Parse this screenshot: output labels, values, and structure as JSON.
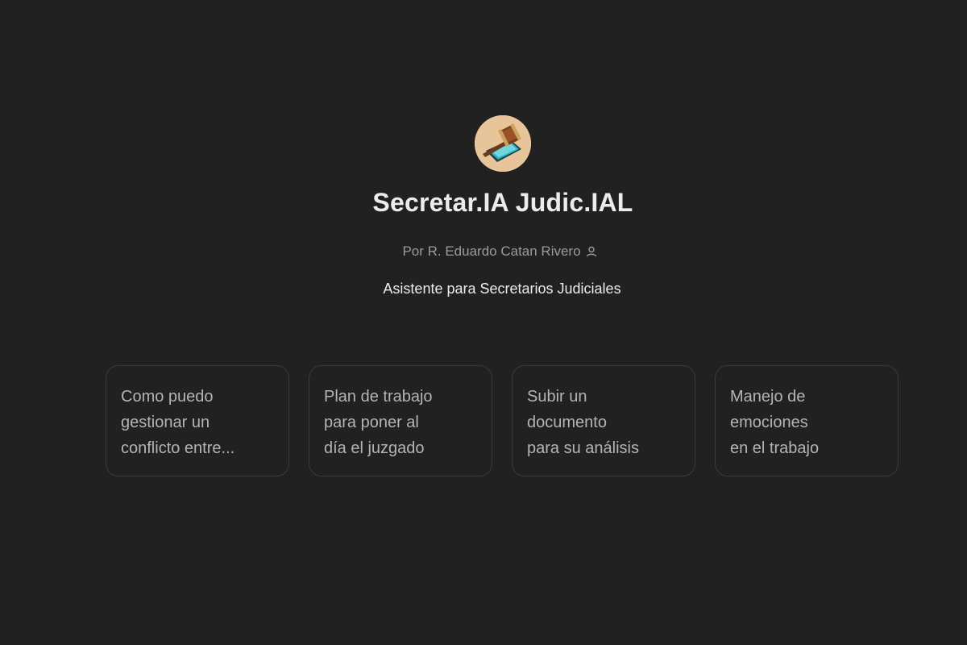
{
  "gpt": {
    "title": "Secretar.IA Judic.IAL",
    "author": "Por R. Eduardo Catan Rivero",
    "description": "Asistente para Secretarios Judiciales",
    "avatar_icon": "gavel-icon",
    "person_icon": "person-icon"
  },
  "starters": [
    {
      "lines": [
        "Como puedo",
        "gestionar un",
        "conflicto entre..."
      ]
    },
    {
      "lines": [
        "Plan de trabajo",
        "para poner al",
        "día el juzgado"
      ]
    },
    {
      "lines": [
        "Subir un",
        "documento",
        "para su análisis"
      ]
    },
    {
      "lines": [
        "Manejo de",
        "emociones",
        "en el trabajo"
      ]
    }
  ],
  "colors": {
    "background": "#212121",
    "title": "#ececec",
    "muted": "#9b9b9b",
    "card_border": "#3a3a3a",
    "card_text": "#b4b4b4"
  }
}
